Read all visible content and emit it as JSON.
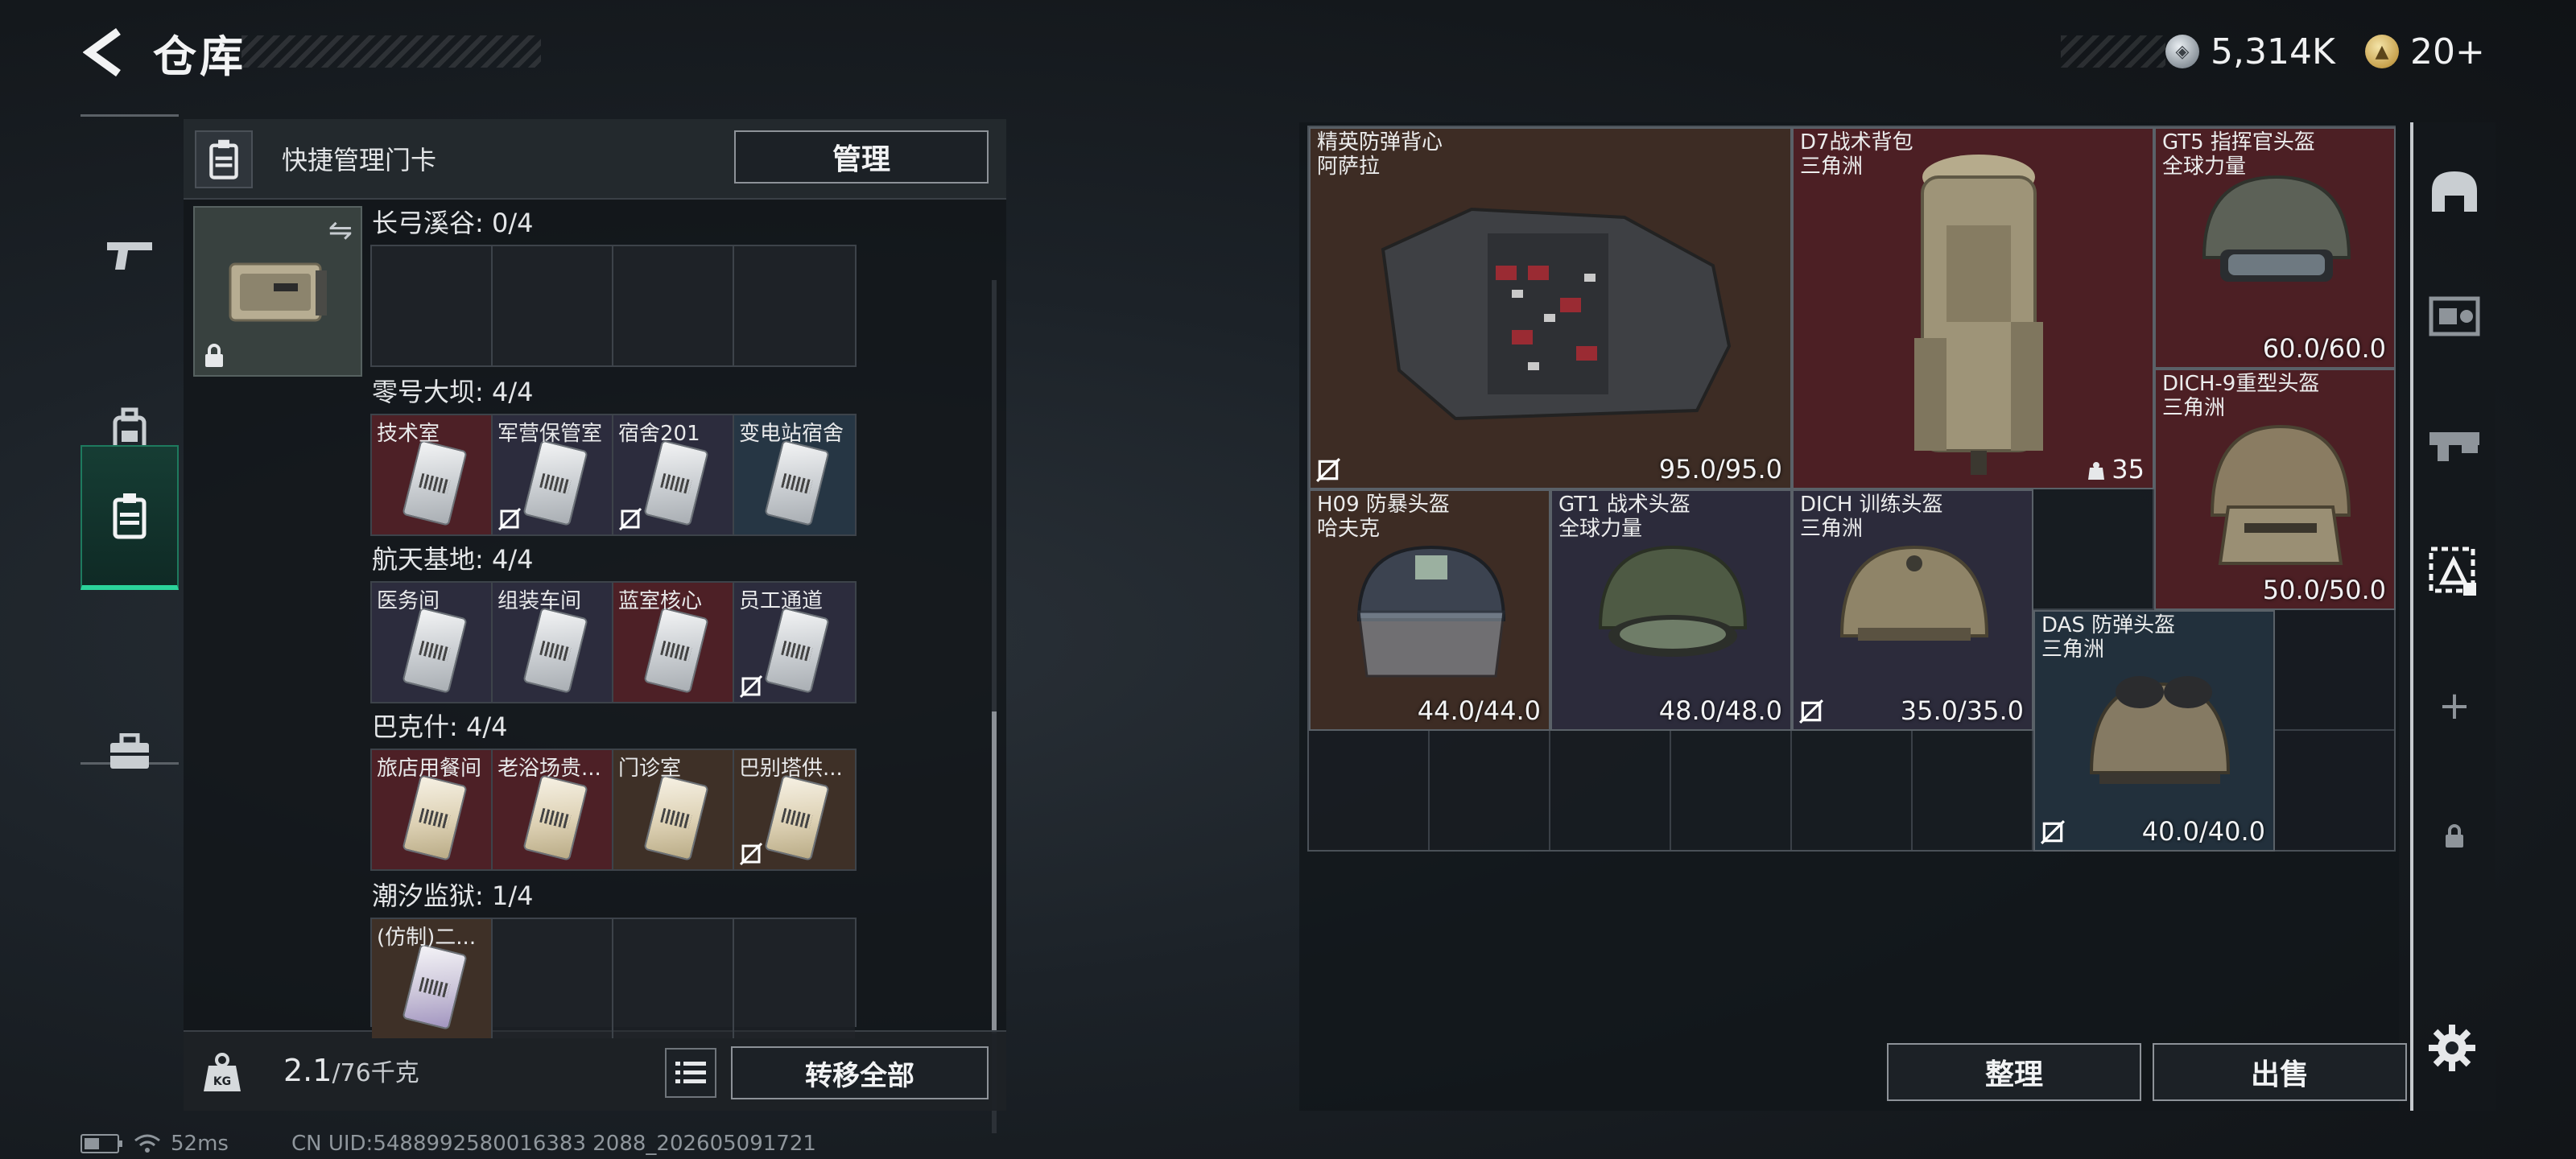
{
  "header": {
    "title": "仓库"
  },
  "currencies": [
    {
      "icon": "silver-coin-icon",
      "value": "5,314K"
    },
    {
      "icon": "gold-coin-icon",
      "value": "20+"
    }
  ],
  "left_rail": {
    "items": [
      {
        "icon": "gun-icon",
        "active": false
      },
      {
        "icon": "backpack-icon",
        "active": false
      },
      {
        "icon": "keycard-holder-icon",
        "active": true
      },
      {
        "icon": "briefcase-icon",
        "active": false
      }
    ]
  },
  "left_panel": {
    "header_title": "快捷管理门卡",
    "manage_label": "管理",
    "sections": [
      {
        "label": "长弓溪谷: 0/4",
        "slots": [
          {
            "name": "",
            "color": "empty"
          },
          {
            "name": "",
            "color": "empty"
          },
          {
            "name": "",
            "color": "empty"
          },
          {
            "name": "",
            "color": "empty"
          }
        ]
      },
      {
        "label": "零号大坝: 4/4",
        "slots": [
          {
            "name": "技术室",
            "color": "red",
            "nolock": false
          },
          {
            "name": "军营保管室",
            "color": "purple",
            "nolock": true
          },
          {
            "name": "宿舍201",
            "color": "purple",
            "nolock": true
          },
          {
            "name": "变电站宿舍",
            "color": "blue",
            "nolock": false
          }
        ]
      },
      {
        "label": "航天基地: 4/4",
        "slots": [
          {
            "name": "医务间",
            "color": "purple",
            "nolock": false
          },
          {
            "name": "组装车间",
            "color": "purple",
            "nolock": false
          },
          {
            "name": "蓝室核心",
            "color": "red",
            "nolock": false
          },
          {
            "name": "员工通道",
            "color": "purple",
            "nolock": true
          }
        ]
      },
      {
        "label": "巴克什: 4/4",
        "slots": [
          {
            "name": "旅店用餐间",
            "color": "red",
            "nolock": false
          },
          {
            "name": "老浴场贵...",
            "color": "red",
            "nolock": false
          },
          {
            "name": "门诊室",
            "color": "brown",
            "nolock": false
          },
          {
            "name": "巴别塔供...",
            "color": "brown",
            "nolock": true
          }
        ]
      },
      {
        "label": "潮汐监狱: 1/4",
        "slots": [
          {
            "name": "(仿制)二...",
            "color": "brown",
            "nolock": false
          },
          {
            "name": "",
            "color": "empty"
          },
          {
            "name": "",
            "color": "empty"
          },
          {
            "name": "",
            "color": "empty"
          }
        ]
      }
    ],
    "weight_value": "2.1",
    "weight_unit": "/76千克",
    "transfer_all_label": "转移全部",
    "weight_icon_label": "KG"
  },
  "right_panel": {
    "items": [
      {
        "name": "精英防弹背心",
        "sub": "阿萨拉",
        "durability": "95.0/95.0",
        "color": "brown",
        "nolock": true
      },
      {
        "name": "D7战术背包",
        "sub": "三角洲",
        "capacity": "35",
        "color": "red"
      },
      {
        "name": "GT5 指挥官头盔",
        "sub": "全球力量",
        "durability": "60.0/60.0",
        "color": "red"
      },
      {
        "name": "DICH-9重型头盔",
        "sub": "三角洲",
        "durability": "50.0/50.0",
        "color": "red"
      },
      {
        "name": "H09 防暴头盔",
        "sub": "哈夫克",
        "durability": "44.0/44.0",
        "color": "brown"
      },
      {
        "name": "GT1 战术头盔",
        "sub": "全球力量",
        "durability": "48.0/48.0",
        "color": "purple"
      },
      {
        "name": "DICH 训练头盔",
        "sub": "三角洲",
        "durability": "35.0/35.0",
        "color": "purple",
        "nolock": true
      },
      {
        "name": "DAS 防弹头盔",
        "sub": "三角洲",
        "durability": "40.0/40.0",
        "color": "blue",
        "nolock": true
      }
    ],
    "organize_label": "整理",
    "sell_label": "出售"
  },
  "right_rail": {
    "items": [
      {
        "icon": "helmet-icon"
      },
      {
        "icon": "armor-rig-icon"
      },
      {
        "icon": "weapon-case-icon"
      },
      {
        "icon": "gear-filter-icon",
        "active": true
      },
      {
        "icon": "plus-icon",
        "label": "+"
      },
      {
        "icon": "lock-icon"
      }
    ]
  },
  "status_bar": {
    "ping": "52ms",
    "uid": "CN UID:5488992580016383 2088_202605091721"
  }
}
